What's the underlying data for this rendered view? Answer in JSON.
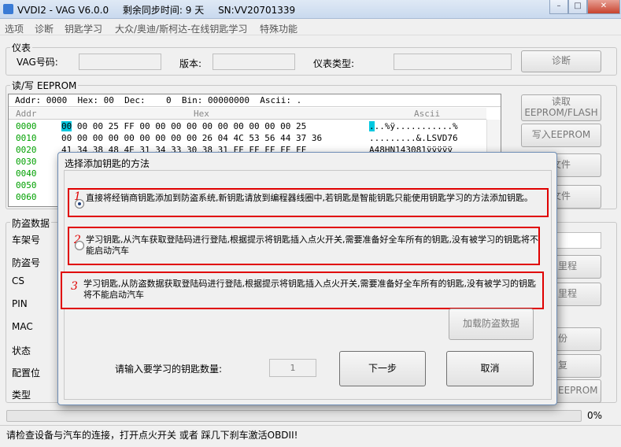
{
  "window": {
    "title_parts": [
      "VVDI2 - VAG V6.0.0",
      "剩余同步时间: 9 天",
      "SN:VV20701339"
    ]
  },
  "menu": [
    "选项",
    "诊断",
    "钥匙学习",
    "大众/奥迪/斯柯达-在线钥匙学习",
    "特殊功能"
  ],
  "instrument": {
    "group_title": "仪表",
    "vag_label": "VAG号码:",
    "version_label": "版本:",
    "type_label": "仪表类型:",
    "diagnose_button": "诊断"
  },
  "eeprom": {
    "group_title": "读/写 EEPROM",
    "addr_bar": "Addr: 0000  Hex: 00  Dec:    0  Bin: 00000000  Ascii: .",
    "col_addr": "Addr",
    "col_hex": "Hex",
    "col_ascii": "Ascii",
    "rows": [
      {
        "addr": "0000",
        "hex": "00 00 00 25 FF 00 00 00 00 00 00 00 00 00 00 25",
        "ascii": "...%ÿ...........%"
      },
      {
        "addr": "0010",
        "hex": "00 00 00 00 00 00 00 00 00 26 04 4C 53 56 44 37 36",
        "ascii": ".........&.LSVD76"
      },
      {
        "addr": "0020",
        "hex": "41 34 38 48 4E 31 34 33 30 38 31 FF FF FF FF FF",
        "ascii": "A48HN143081ÿÿÿÿÿ"
      },
      {
        "addr": "0030",
        "hex": "",
        "ascii": ""
      },
      {
        "addr": "0040",
        "hex": "",
        "ascii": ""
      },
      {
        "addr": "0050",
        "hex": "",
        "ascii": ""
      },
      {
        "addr": "0060",
        "hex": "",
        "ascii": ""
      }
    ],
    "read_button": "读取\nEEPROM/FLASH",
    "write_button": "写入EEPROM",
    "file_button1": "文件",
    "file_button2": "文件"
  },
  "immo": {
    "group_title": "防盗数据",
    "labels": [
      "车架号",
      "防盗号",
      "CS",
      "PIN",
      "MAC",
      "状态",
      "配置位",
      "类型"
    ],
    "right_buttons": [
      "里程",
      "里程",
      "份",
      "复",
      "EEPROM"
    ]
  },
  "progress": {
    "value": 0,
    "label": "0%"
  },
  "status_text": "请检查设备与汽车的连接，打开点火开关 或者 踩几下刹车激活OBDII!",
  "dialog": {
    "title": "选择添加钥匙的方法",
    "options": [
      {
        "num": "1",
        "selected": true,
        "text": "直接将经销商钥匙添加到防盗系统,新钥匙请放到编程器线圈中,若钥匙是智能钥匙只能使用钥匙学习的方法添加钥匙。"
      },
      {
        "num": "2",
        "selected": false,
        "text": "学习钥匙,从汽车获取登陆码进行登陆,根据提示将钥匙插入点火开关,需要准备好全车所有的钥匙,没有被学习的钥匙将不能启动汽车"
      },
      {
        "num": "3",
        "selected": false,
        "text": "学习钥匙,从防盗数据获取登陆码进行登陆,根据提示将钥匙插入点火开关,需要准备好全车所有的钥匙,没有被学习的钥匙将不能启动汽车"
      }
    ],
    "load_button": "加载防盗数据",
    "count_label": "请输入要学习的钥匙数量:",
    "count_value": "1",
    "next_button": "下一步",
    "cancel_button": "取消"
  },
  "colors": {
    "accent_red": "#e00000",
    "selection": "#00c8e0",
    "addr_green": "#00a000"
  }
}
